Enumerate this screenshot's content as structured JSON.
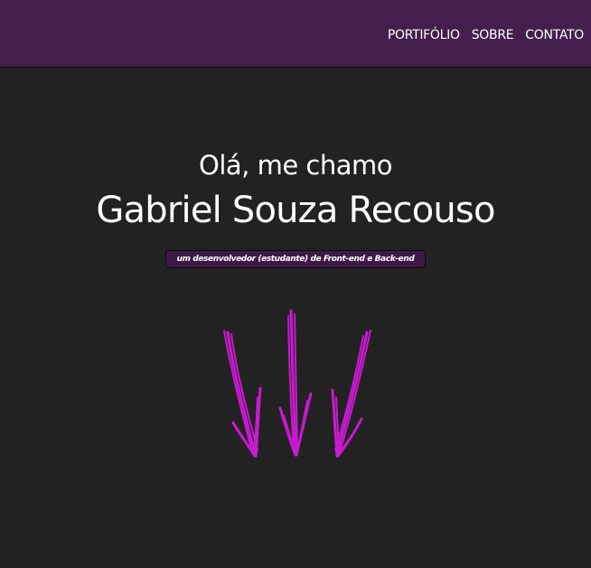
{
  "nav": {
    "links": [
      "PORTIFÓLIO",
      "SOBRE",
      "CONTATO"
    ]
  },
  "hero": {
    "greeting": "Olá, me chamo",
    "name": "Gabriel Souza Recouso",
    "tagline": "um desenvolvedor (estudante) de Front-end e Back-end"
  },
  "colors": {
    "navbar": "#441e4c",
    "background": "#232223",
    "arrows": "#c81ad0",
    "tagline_bg": "#3d1a45"
  },
  "icons": {
    "arrows": "arrow-down-icon"
  }
}
